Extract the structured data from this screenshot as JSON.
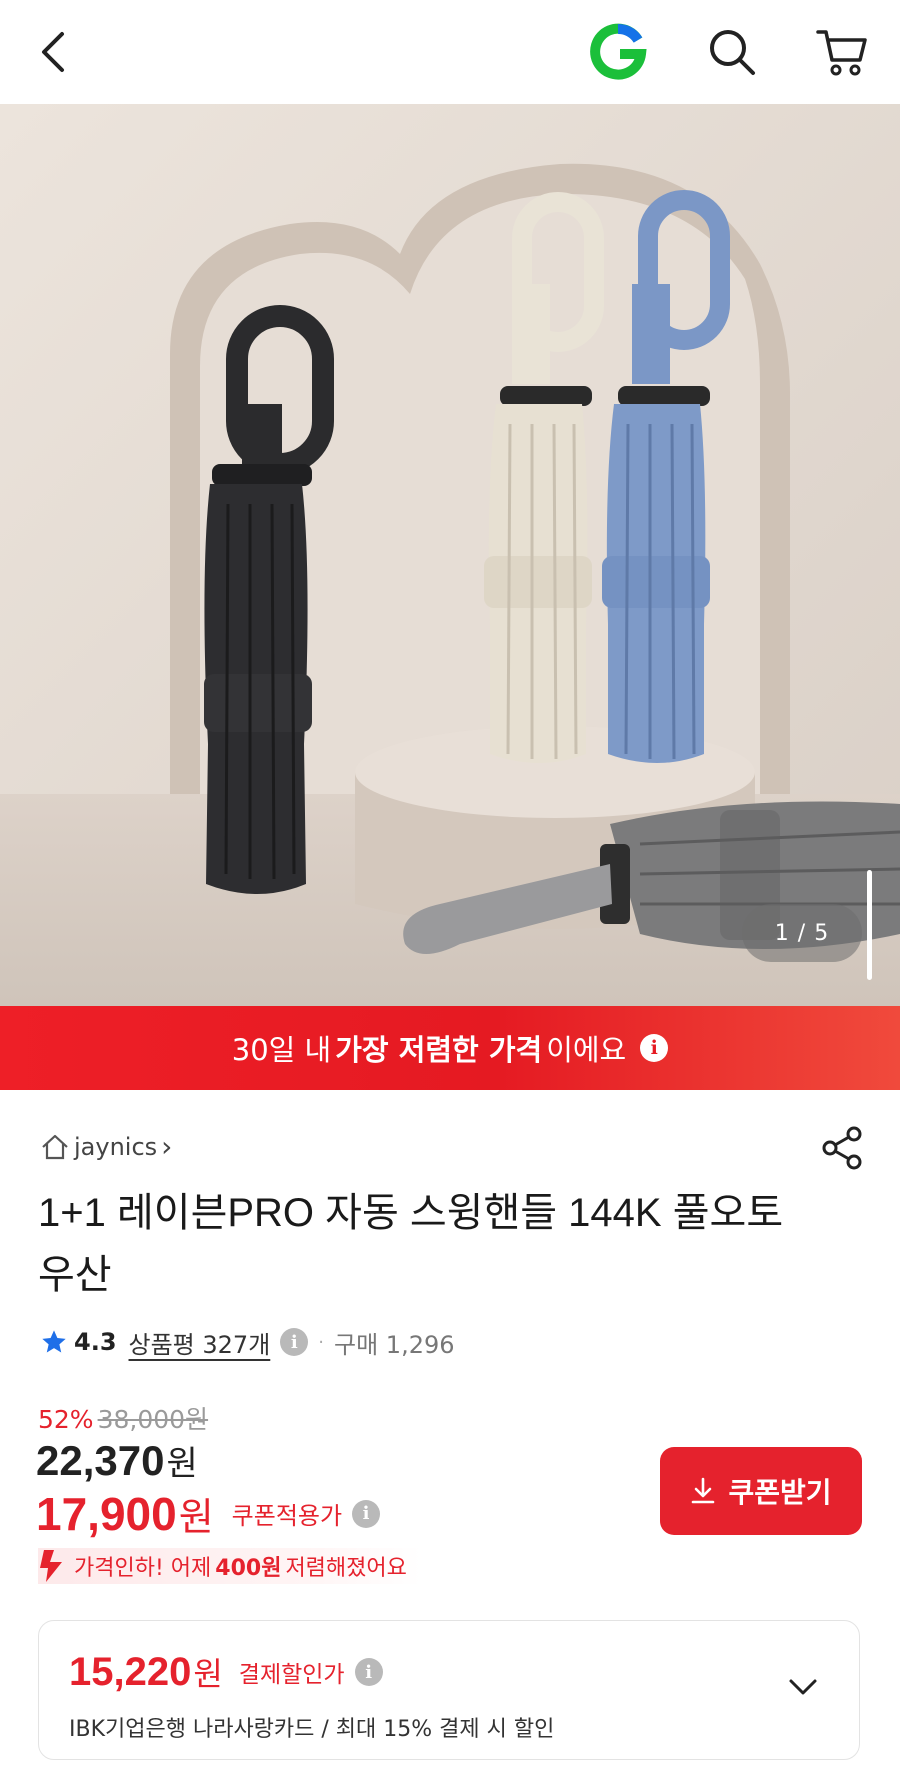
{
  "header": {
    "back_icon": "chevron-left-icon",
    "brand_icon": "gmarket-g-logo",
    "search_icon": "search-icon",
    "cart_icon": "cart-icon",
    "brand_color": "#1bbf3a"
  },
  "gallery": {
    "counter": "1 / 5"
  },
  "banner": {
    "prefix": "30일 내",
    "highlight": "가장 저렴한 가격",
    "suffix": "이에요",
    "info_icon": "info-icon",
    "color": "#e51a22"
  },
  "store": {
    "name": "jaynics",
    "arrow": "›"
  },
  "product": {
    "title": "1+1 레이븐PRO 자동 스윙핸들 144K 풀오토 우산"
  },
  "rating": {
    "score": "4.3",
    "reviews": "상품평 327개",
    "separator": "·",
    "purchases": "구매 1,296"
  },
  "pricing": {
    "discount_rate": "52%",
    "original_price": "38,000원",
    "sale_price": "22,370",
    "sale_unit": "원",
    "coupon_price": "17,900",
    "coupon_unit": "원",
    "coupon_label": "쿠폰적용가",
    "drop_prefix": "가격인하! 어제",
    "drop_amount": "400원",
    "drop_suffix": "저렴해졌어요",
    "accent_color": "#e5222d"
  },
  "coupon_button": {
    "label": "쿠폰받기"
  },
  "payment": {
    "price": "15,220",
    "unit": "원",
    "label": "결제할인가",
    "description": "IBK기업은행 나라사랑카드 / 최대 15% 결제 시 할인"
  }
}
